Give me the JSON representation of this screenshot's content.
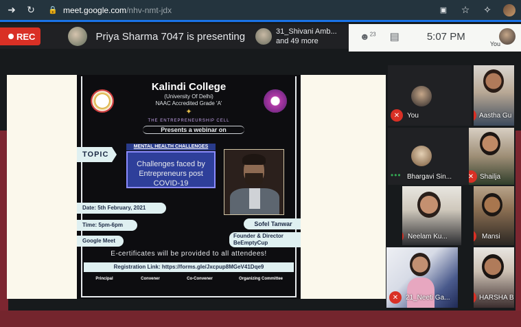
{
  "browser": {
    "url_host": "meet.google.com",
    "url_path": "/nhv-nmt-jdx",
    "icons": [
      "arrow-right-icon",
      "reload-icon",
      "lock-icon",
      "camera-icon",
      "star-icon",
      "extensions-icon",
      "profile-icon"
    ]
  },
  "meet": {
    "rec_label": "REC",
    "presenting_text": "Priya Sharma 7047 is presenting",
    "participant_name": "31_Shivani Amb...",
    "participant_more": "and 49 more",
    "participants_count": "23",
    "clock": "5:07 PM",
    "self_label": "You"
  },
  "poster": {
    "college": "Kalindi College",
    "college_sub1": "(University Of Delhi)",
    "college_sub2": "NAAC Accredited Grade 'A'",
    "cell": "THE ENTREPRENEURSHIP CELL",
    "presents": "Presents a webinar on",
    "topic_tag": "TOPIC",
    "mh_label": "MENTAL HEALTH CHALLENGES",
    "topic_text": "Challenges faced by Entrepreneurs post COVID-19",
    "date": "Date: 5th February, 2021",
    "time": "Time: 5pm-6pm",
    "platform": "Google Meet",
    "speaker": "Sofel Tanwar",
    "role1": "Founder & Director",
    "role2": "BeEmptyCup",
    "ecert": "E-certificates will be provided to all attendees!",
    "registration": "Registration Link: https://forms.gle/Jxcpup8MGeV41Dqe9",
    "principal": "Principal",
    "convener": "Convener",
    "coconvener": "Co-Convener",
    "organizing": "Organizing Committee"
  },
  "tiles": [
    {
      "name": "You"
    },
    {
      "name": "Aastha Gu"
    },
    {
      "name": "Bhargavi Sin..."
    },
    {
      "name": "Shailja"
    },
    {
      "name": "Neelam Ku..."
    },
    {
      "name": "Mansi"
    },
    {
      "name": "21_Neeti Ga..."
    },
    {
      "name": "HARSHA B"
    }
  ],
  "colors": {
    "rec": "#d93025",
    "accent": "#1a73e8",
    "maroon": "#7c2630"
  }
}
